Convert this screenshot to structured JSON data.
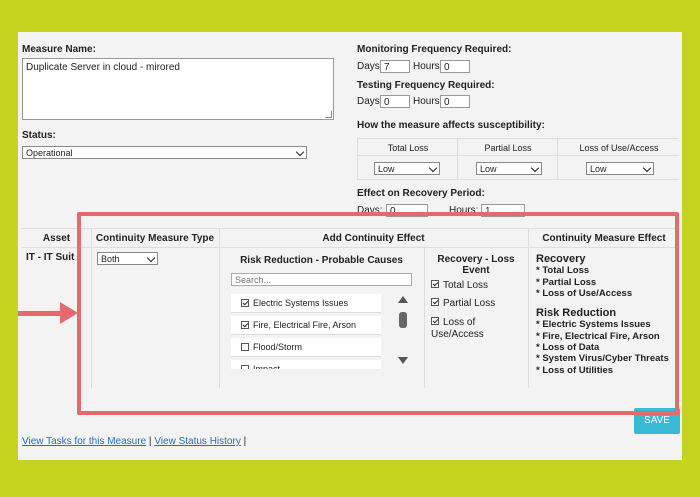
{
  "form": {
    "measure_name_label": "Measure Name:",
    "measure_name_value": "Duplicate Server in cloud - mirored",
    "status_label": "Status:",
    "status_value": "Operational",
    "monitoring_label": "Monitoring Frequency Required:",
    "testing_label": "Testing Frequency Required:",
    "days_label": "Days",
    "hours_label": "Hours",
    "monitoring_days": "7",
    "monitoring_hours": "0",
    "testing_days": "0",
    "testing_hours": "0",
    "susceptibility_label": "How the measure affects susceptibility:",
    "susceptibility_columns": [
      {
        "name": "Total Loss",
        "value": "Low"
      },
      {
        "name": "Partial Loss",
        "value": "Low"
      },
      {
        "name": "Loss of Use/Access",
        "value": "Low"
      }
    ],
    "recovery_label": "Effect on Recovery Period:",
    "recovery_days_label": "Days:",
    "recovery_hours_label": "Hours:",
    "recovery_days_value": "0",
    "recovery_hours_value": "1"
  },
  "table": {
    "headers": {
      "asset": "Asset",
      "type": "Continuity Measure Type",
      "add_effect": "Add Continuity Effect",
      "measure_effect": "Continuity Measure Effect"
    },
    "row": {
      "asset": "IT - IT Suit",
      "type": "Both"
    },
    "risk_reduction_header": "Risk Reduction - Probable Causes",
    "search_placeholder": "Search...",
    "causes": [
      {
        "label": "Electric Systems Issues",
        "checked": true
      },
      {
        "label": "Fire, Electrical Fire, Arson",
        "checked": true
      },
      {
        "label": "Flood/Storm",
        "checked": false
      },
      {
        "label": "Impact",
        "checked": false
      }
    ],
    "recovery_header_line1": "Recovery - Loss",
    "recovery_header_line2": "Event",
    "recovery_options": [
      {
        "label": "Total Loss",
        "checked": true
      },
      {
        "label": "Partial Loss",
        "checked": true
      },
      {
        "label": "Loss of",
        "label2": "Use/Access",
        "checked": true
      }
    ],
    "effect_summary": {
      "recovery_title": "Recovery",
      "recovery_items": [
        "* Total Loss",
        "* Partial Loss",
        "* Loss of Use/Access"
      ],
      "risk_title": "Risk Reduction",
      "risk_items": [
        "* Electric Systems Issues",
        "* Fire, Electrical Fire, Arson",
        "* Loss of Data",
        "* System Virus/Cyber Threats",
        "* Loss of Utilities"
      ]
    }
  },
  "actions": {
    "save": "SAVE",
    "view_tasks": "View Tasks for this Measure",
    "view_status": "View Status History",
    "separator": "|"
  },
  "colors": {
    "background": "#c5d41e",
    "highlight": "#e66a6d",
    "save_button": "#38b9d6",
    "link": "#2a6ebd"
  }
}
